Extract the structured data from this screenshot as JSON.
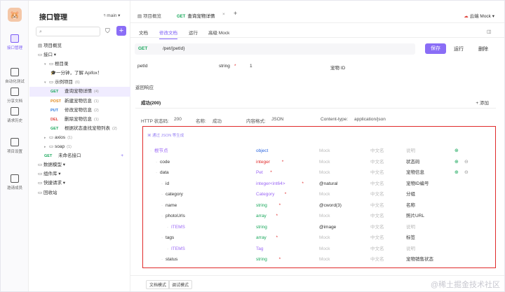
{
  "nav": {
    "logo": "🐹",
    "items": [
      {
        "label": "接口管理",
        "active": true
      },
      {
        "label": "自动化测试"
      },
      {
        "label": "分享文档"
      },
      {
        "label": "请求历史"
      },
      {
        "label": "项目设置"
      },
      {
        "label": "邀请成员"
      }
    ]
  },
  "sidebar": {
    "title": "接口管理",
    "branch": "ᵑ main ▾",
    "search_placeholder": "",
    "tree": [
      {
        "text": "项目概览",
        "indent": 0,
        "icon": "▤"
      },
      {
        "text": "接口 ▾",
        "indent": 0,
        "icon": "▭"
      },
      {
        "text": "根目录",
        "indent": 1,
        "icon": "▭",
        "caret": "▾"
      },
      {
        "text": "一分钟，了解 Apifox！",
        "indent": 2,
        "icon": "🎓"
      },
      {
        "text": "示例项目",
        "count": "(6)",
        "indent": 1,
        "icon": "▭",
        "caret": "▾"
      },
      {
        "method": "GET",
        "cls": "m-get",
        "text": "查询宠物详情",
        "count": "(4)",
        "indent": 2,
        "selected": true
      },
      {
        "method": "POST",
        "cls": "m-post",
        "text": "新建宠物信息",
        "count": "(1)",
        "indent": 2
      },
      {
        "method": "PUT",
        "cls": "m-put",
        "text": "修改宠物信息",
        "count": "(2)",
        "indent": 2
      },
      {
        "method": "DEL",
        "cls": "m-del",
        "text": "删除宠物信息",
        "count": "(1)",
        "indent": 2
      },
      {
        "method": "GET",
        "cls": "m-get",
        "text": "根据状态查找宠物列表",
        "count": "(2)",
        "indent": 2
      },
      {
        "text": "axios",
        "count": "(1)",
        "indent": 1,
        "icon": "▭",
        "caret": "▸"
      },
      {
        "text": "soap",
        "count": "(1)",
        "indent": 1,
        "icon": "▭",
        "caret": "▸"
      },
      {
        "method": "GET",
        "cls": "m-get",
        "text": "未命名接口",
        "indent": 1,
        "add": "+"
      },
      {
        "text": "数据模型 ▾",
        "indent": 0,
        "icon": "▭"
      },
      {
        "text": "组件库 ▾",
        "indent": 0,
        "icon": "▭"
      },
      {
        "text": "快捷请求 ▾",
        "indent": 0,
        "icon": "▭"
      },
      {
        "text": "回收站",
        "indent": 0,
        "icon": "▭"
      }
    ]
  },
  "top_tabs": [
    {
      "label": "项目概览"
    },
    {
      "method": "GET",
      "label": "查询宠物详情",
      "active": true
    }
  ],
  "tab_close": "×",
  "tab_add": "+",
  "env": "云端 Mock ▾",
  "subtabs": [
    "文档",
    "修改文档",
    "运行",
    "高级 Mock"
  ],
  "request": {
    "method": "GET",
    "path": "/pet/{petId}"
  },
  "actions": {
    "save": "保存",
    "run": "运行",
    "delete": "删除"
  },
  "param": {
    "name": "petId",
    "type": "string",
    "required": "*",
    "value": "1",
    "desc": "宠物 ID"
  },
  "response": {
    "section_title": "返回响应",
    "tab": "成功(200)",
    "add": "+ 添加",
    "status_label": "HTTP 状态码:",
    "status": "200",
    "name_label": "名称:",
    "name": "成功",
    "format_label": "内容格式:",
    "format": "JSON",
    "ctype_label": "Content-type:",
    "ctype": "application/json"
  },
  "schema": {
    "tip": "⌘ 通过 JSON 等生成",
    "rows": [
      {
        "name": "根节点",
        "name_muted": true,
        "type": "object",
        "tcls": "blue",
        "mock": "Mock",
        "cn": "中文名",
        "desc": "说明",
        "indent": 0
      },
      {
        "name": "code",
        "type": "integer",
        "tcls": "req",
        "req": true,
        "mock": "Mock",
        "cn": "中文名",
        "desc": "状态码",
        "indent": 1
      },
      {
        "name": "data",
        "type": "Pet",
        "tcls": "purple",
        "req": true,
        "mock": "Mock",
        "cn": "中文名",
        "desc": "宠物信息",
        "indent": 1
      },
      {
        "name": "id",
        "type": "integer<int64>",
        "tcls": "purple",
        "req": true,
        "mock": "@natural",
        "mock_dark": true,
        "cn": "中文名",
        "desc": "宠物ID编号",
        "indent": 2
      },
      {
        "name": "category",
        "type": "Category",
        "tcls": "purple",
        "req": true,
        "mock": "Mock",
        "cn": "中文名",
        "desc": "分组",
        "indent": 2
      },
      {
        "name": "name",
        "type": "string",
        "tcls": "green",
        "req": true,
        "mock": "@cword(3)",
        "mock_dark": true,
        "cn": "中文名",
        "desc": "名称",
        "indent": 2
      },
      {
        "name": "photoUrls",
        "type": "array",
        "tcls": "green",
        "req": true,
        "mock": "Mock",
        "cn": "中文名",
        "desc": "照片URL",
        "indent": 2
      },
      {
        "name": "ITEMS",
        "name_muted": true,
        "type": "string",
        "tcls": "green",
        "mock": "@image",
        "mock_dark": true,
        "cn": "中文名",
        "desc": "说明",
        "indent": 3
      },
      {
        "name": "tags",
        "type": "array",
        "tcls": "green",
        "req": true,
        "mock": "Mock",
        "cn": "中文名",
        "desc": "标签",
        "indent": 2
      },
      {
        "name": "ITEMS",
        "name_muted": true,
        "type": "Tag",
        "tcls": "purple",
        "mock": "Mock",
        "cn": "中文名",
        "desc": "说明",
        "indent": 3
      },
      {
        "name": "status",
        "type": "string",
        "tcls": "green",
        "req": true,
        "mock": "Mock",
        "cn": "中文名",
        "desc": "宠物销售状态",
        "indent": 2
      }
    ]
  },
  "footer": {
    "mode1": "文档模式",
    "mode2": "调试模式",
    "watermark": "@稀土掘金技术社区"
  }
}
